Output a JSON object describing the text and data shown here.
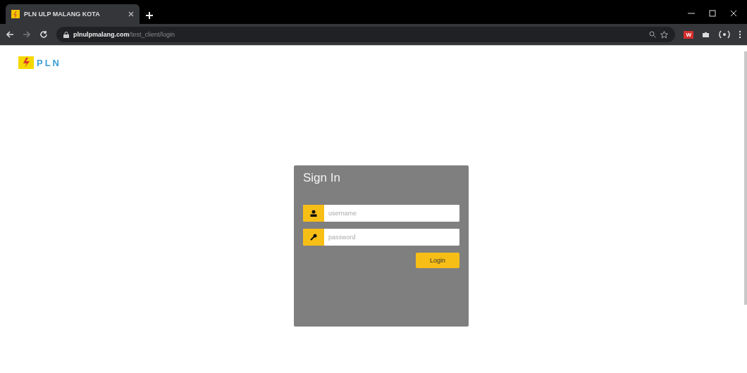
{
  "browser": {
    "tab_title": "PLN ULP MALANG KOTA",
    "url_host": "plnulpmalang.com",
    "url_path": "/test_client/login",
    "extension_badge": "W"
  },
  "logo": {
    "text": "PLN"
  },
  "login": {
    "title": "Sign In",
    "fields": [
      {
        "kind": "user",
        "placeholder": "username"
      },
      {
        "kind": "password",
        "placeholder": "password"
      }
    ],
    "button": "Login"
  }
}
